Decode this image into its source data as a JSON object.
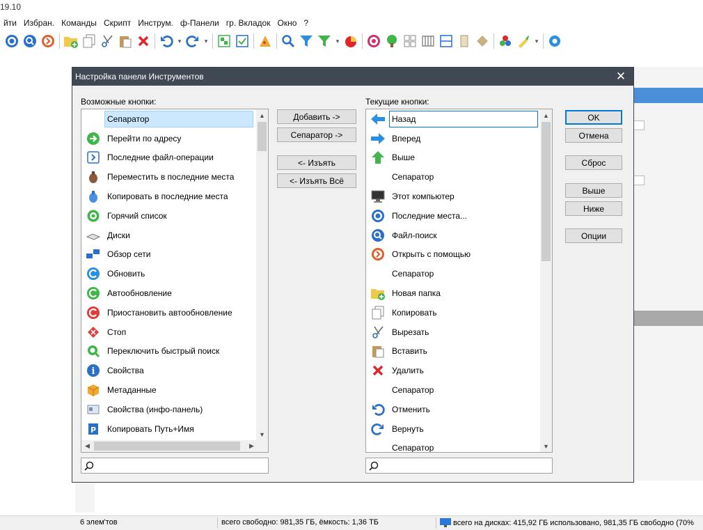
{
  "app": {
    "version": "19.10",
    "menu": [
      "йти",
      "Избран.",
      "Команды",
      "Скрипт",
      "Инструм.",
      "ф-Панели",
      "гр. Вкладок",
      "Окно",
      "?"
    ]
  },
  "toolbar": {
    "icons": [
      "recent-places-icon",
      "file-search-icon",
      "open-with-icon",
      "new-folder-icon",
      "copy-icon",
      "cut-icon",
      "paste-icon",
      "delete-icon",
      "undo-icon",
      "redo-icon",
      "sync-icon",
      "select-icon",
      "pizza-icon",
      "search-icon",
      "filter-icon",
      "filter-green-icon",
      "pie-icon",
      "target-icon",
      "tree-icon",
      "grid-icon",
      "columns-icon",
      "split-icon",
      "panel-icon",
      "tag-icon",
      "colors-icon",
      "brush-icon",
      "gear-icon"
    ]
  },
  "dialog": {
    "title": "Настройка панели Инструментов",
    "close": "✕",
    "available_label": "Возможные кнопки:",
    "current_label": "Текущие кнопки:",
    "buttons": {
      "add": "Добавить ->",
      "separator": "Сепаратор ->",
      "remove": "<- Изъять",
      "remove_all": "<- Изъять Всё",
      "ok": "OK",
      "cancel": "Отмена",
      "reset": "Сброс",
      "up": "Выше",
      "down": "Ниже",
      "options": "Опции"
    },
    "available_items": [
      {
        "label": "Сепаратор",
        "icon": ""
      },
      {
        "label": "Перейти по адресу",
        "icon": "goto-icon"
      },
      {
        "label": "Последние файл-операции",
        "icon": "recent-ops-icon"
      },
      {
        "label": "Переместить в последние места",
        "icon": "move-recent-icon"
      },
      {
        "label": "Копировать в последние места",
        "icon": "copy-recent-icon"
      },
      {
        "label": "Горячий список",
        "icon": "hotlist-icon"
      },
      {
        "label": "Диски",
        "icon": "drives-icon"
      },
      {
        "label": "Обзор сети",
        "icon": "network-icon"
      },
      {
        "label": "Обновить",
        "icon": "refresh-icon"
      },
      {
        "label": "Автообновление",
        "icon": "autorefresh-icon"
      },
      {
        "label": "Приостановить автообновление",
        "icon": "pause-autorefresh-icon"
      },
      {
        "label": "Стоп",
        "icon": "stop-icon"
      },
      {
        "label": "Переключить быстрый поиск",
        "icon": "quick-search-icon"
      },
      {
        "label": "Свойства",
        "icon": "info-icon"
      },
      {
        "label": "Метаданные",
        "icon": "metadata-icon"
      },
      {
        "label": "Свойства (инфо-панель)",
        "icon": "info-panel-icon"
      },
      {
        "label": "Копировать Путь+Имя",
        "icon": "copy-path-icon"
      }
    ],
    "current_items": [
      {
        "label": "Назад",
        "icon": "back-arrow-icon"
      },
      {
        "label": "Вперед",
        "icon": "forward-arrow-icon"
      },
      {
        "label": "Выше",
        "icon": "up-arrow-icon"
      },
      {
        "label": "Сепаратор",
        "icon": ""
      },
      {
        "label": "Этот компьютер",
        "icon": "computer-icon"
      },
      {
        "label": "Последние места...",
        "icon": "recent-places-icon"
      },
      {
        "label": "Файл-поиск",
        "icon": "file-search-icon"
      },
      {
        "label": "Открыть с помощью",
        "icon": "open-with-icon"
      },
      {
        "label": "Сепаратор",
        "icon": ""
      },
      {
        "label": "Новая папка",
        "icon": "new-folder-icon"
      },
      {
        "label": "Копировать",
        "icon": "copy-icon"
      },
      {
        "label": "Вырезать",
        "icon": "cut-icon"
      },
      {
        "label": "Вставить",
        "icon": "paste-icon"
      },
      {
        "label": "Удалить",
        "icon": "delete-icon"
      },
      {
        "label": "Сепаратор",
        "icon": ""
      },
      {
        "label": "Отменить",
        "icon": "undo-icon"
      },
      {
        "label": "Вернуть",
        "icon": "redo-icon"
      },
      {
        "label": "Сепаратор",
        "icon": ""
      }
    ],
    "search_left": "",
    "search_right": ""
  },
  "status": {
    "items": "6 элем'тов",
    "free": "всего свободно: 981,35 ГБ, ёмкость: 1,36 ТБ",
    "disks": "всего на дисках: 415,92 ГБ использовано,   981,35 ГБ свободно (70%"
  }
}
